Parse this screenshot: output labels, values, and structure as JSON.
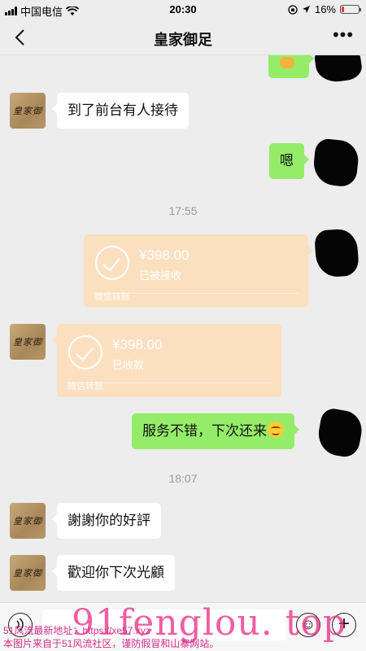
{
  "status_bar": {
    "carrier": "中国电信",
    "time": "20:30",
    "battery_percent": "16%",
    "battery_level": 0.16
  },
  "nav": {
    "title": "皇家御足",
    "more_label": "•••"
  },
  "messages": {
    "m1": {
      "text": "到了前台有人接待"
    },
    "m2": {
      "text": "嗯"
    },
    "ts1": "17:55",
    "t1": {
      "amount": "¥398.00",
      "status": "已被接收",
      "footer": "微信转账"
    },
    "t2": {
      "amount": "¥398.00",
      "status": "已收款",
      "footer": "微信转账"
    },
    "m3": {
      "text": "服务不错，下次还来"
    },
    "ts2": "18:07",
    "m4": {
      "text": "謝謝你的好評"
    },
    "m5": {
      "text": "歡迎你下次光顧"
    }
  },
  "watermark": {
    "big": "91fenglou. top",
    "line1": "51风流最新地址：https://xe57.xyz",
    "line2": "本图片来自于51风流社区，谨防假冒和山寨网站。"
  },
  "colors": {
    "outgoing_bubble": "#95ec69",
    "incoming_bubble": "#ffffff",
    "transfer_card": "#fbe0c0",
    "watermark": "#d2308a"
  },
  "icons": [
    "back-chevron-icon",
    "more-dots-icon",
    "voice-icon",
    "emoji-icon",
    "plus-icon",
    "checkmark-icon",
    "wifi-icon",
    "signal-icon",
    "battery-icon"
  ]
}
